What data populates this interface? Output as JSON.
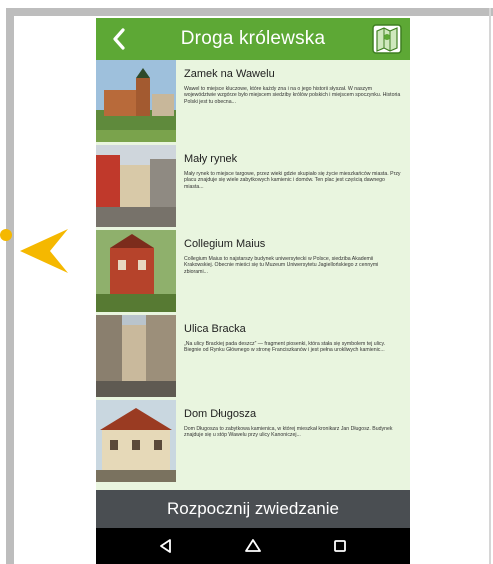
{
  "app": {
    "title": "Droga królewska"
  },
  "header": {
    "back_icon": "chevron-left-icon",
    "map_icon": "map-icon"
  },
  "places": [
    {
      "name": "Zamek na Wawelu",
      "description": "Wawel to miejsce kluczowe, które każdy zna i na o jego historii słyszał. W naszym województwie wzgórze było miejscem siedziby królów polskich i miejscem spoczynku. Historia Polski jest tu obecna..."
    },
    {
      "name": "Mały rynek",
      "description": "Mały rynek to miejsce targowe, przez wieki gdzie skupiało się życie mieszkańców miasta. Przy placu znajduje się wiele zabytkowych kamienic i domów. Ten plac jest częścią dawnego miasta..."
    },
    {
      "name": "Collegium Maius",
      "description": "Collegium Maius to najstarszy budynek uniwersytecki w Polsce, siedziba Akademii Krakowskiej. Obecnie mieści się tu Muzeum Uniwersytetu Jagiellońskiego z cennymi zbiorami..."
    },
    {
      "name": "Ulica Bracka",
      "description": "„Na ulicy Brackiej pada deszcz” — fragment piosenki, która stała się symbolem tej ulicy. Biegnie od Rynku Głównego w stronę Franciszkanów i jest pełna urokliwych kamienic..."
    },
    {
      "name": "Dom Długosza",
      "description": "Dom Długosza to zabytkowa kamienica, w której mieszkał kronikarz Jan Długosz. Budynek znajduje się u stóp Wawelu przy ulicy Kanoniczej..."
    }
  ],
  "footer": {
    "start_label": "Rozpocznij zwiedzanie"
  },
  "android_nav": {
    "back": "back-triangle-icon",
    "home": "home-icon",
    "recents": "recents-square-icon"
  }
}
